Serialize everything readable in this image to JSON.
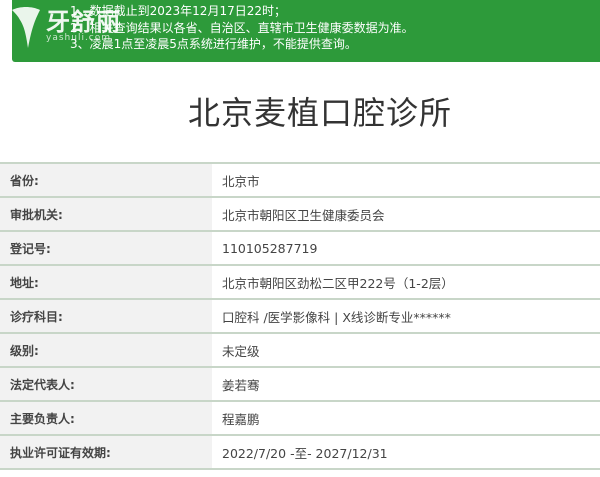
{
  "notice": {
    "lines": [
      "1、数据截止到2023年12月17日22时；",
      "2、相关查询结果以各省、自治区、直辖市卫生健康委数据为准。",
      "3、凌晨1点至凌晨5点系统进行维护，不能提供查询。"
    ]
  },
  "watermark": {
    "text": "牙舒丽",
    "url": "yashuli.com"
  },
  "page": {
    "title": "北京麦植口腔诊所"
  },
  "fields": [
    {
      "label": "省份:",
      "value": "北京市"
    },
    {
      "label": "审批机关:",
      "value": "北京市朝阳区卫生健康委员会"
    },
    {
      "label": "登记号:",
      "value": "110105287719"
    },
    {
      "label": "地址:",
      "value": "北京市朝阳区劲松二区甲222号（1-2层）"
    },
    {
      "label": "诊疗科目:",
      "value": "口腔科 /医学影像科 | X线诊断专业******"
    },
    {
      "label": "级别:",
      "value": "未定级"
    },
    {
      "label": "法定代表人:",
      "value": "姜若骞"
    },
    {
      "label": "主要负责人:",
      "value": "程嘉鹏"
    },
    {
      "label": "执业许可证有效期:",
      "value": "2022/7/20 -至- 2027/12/31"
    }
  ],
  "colors": {
    "notice_bg": "#2d9a3a",
    "label_bg": "#f2f2f2",
    "border": "#c8d6c8"
  }
}
